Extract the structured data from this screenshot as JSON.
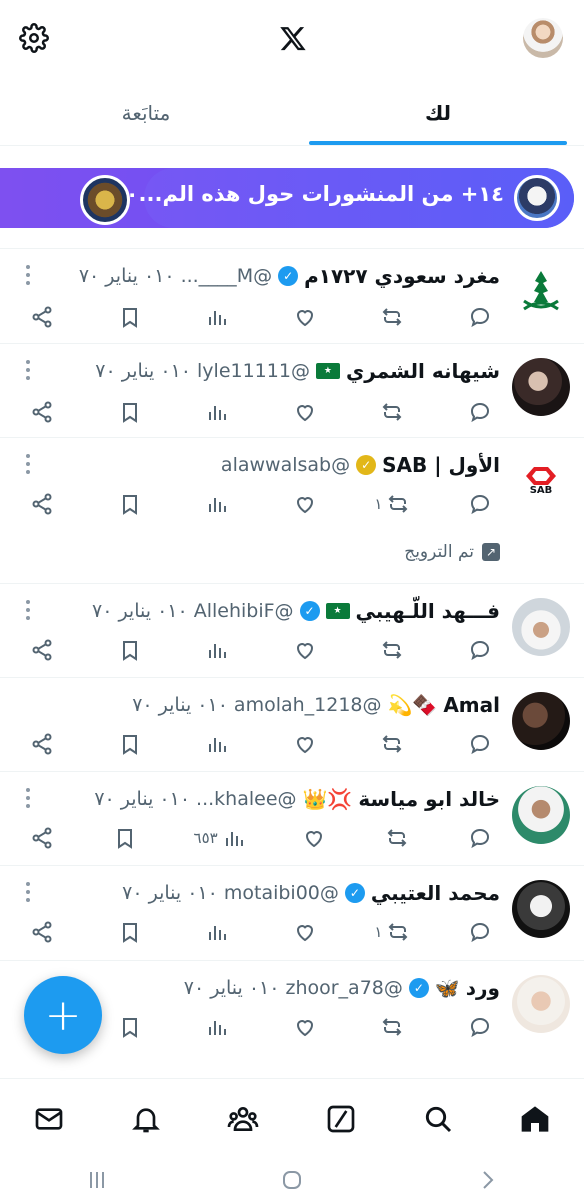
{
  "app": {
    "logo": "X"
  },
  "tabs": [
    {
      "label": "لك",
      "active": true
    },
    {
      "label": "متابَعة",
      "active": false
    }
  ],
  "banner": {
    "text": "١٤+ من المنشورات حول هذه الم...١٠"
  },
  "tweets": [
    {
      "name": "مغرد سعودي ١٧٢٧م",
      "verified": "blue",
      "handle": "@M____...",
      "date": "٠١٠ يناير ٧٠",
      "avatar": "saudi-emblem",
      "views": "",
      "retweets": ""
    },
    {
      "name": "شيهانه الشمري",
      "flag": "🇸🇦",
      "handle": "@lyle11111",
      "date": "٠١٠ يناير ٧٠",
      "avatar": "person",
      "views": "",
      "retweets": ""
    },
    {
      "name": "الأول | SAB",
      "verified": "gold",
      "handle": "@alawwalsab",
      "date": "",
      "avatar": "sab-logo",
      "views": "",
      "retweets": "١",
      "promoted": "تم الترويج"
    },
    {
      "name": "فـــهد اللّـهيبي",
      "flag": "🇸🇦",
      "verified": "blue",
      "handle": "@AllehibiF",
      "date": "٠١٠ يناير ٧٠",
      "avatar": "person",
      "views": "",
      "retweets": ""
    },
    {
      "name": "Amal",
      "emoji": "🍫💫",
      "handle": "@amolah_1218",
      "date": "٠١٠ يناير ٧٠",
      "avatar": "person",
      "views": "",
      "retweets": ""
    },
    {
      "name": "خالد ابو مياسة",
      "emoji": "💢👑",
      "handle": "@khalee...",
      "date": "٠١٠ يناير ٧٠",
      "avatar": "person",
      "views": "٦٥٣",
      "retweets": ""
    },
    {
      "name": "محمد العتيبي",
      "verified": "blue",
      "handle": "@motaibi00",
      "date": "٠١٠ يناير ٧٠",
      "avatar": "person",
      "views": "",
      "retweets": "١"
    },
    {
      "name": "ورد",
      "emoji": "🦋",
      "verified": "blue",
      "handle": "@zhoor_a78",
      "date": "٠١٠ يناير ٧٠",
      "avatar": "person",
      "views": "",
      "retweets": ""
    }
  ],
  "colors": {
    "accent": "#1d9bf0",
    "text": "#0f1419",
    "muted": "#536471",
    "bannerStart": "#7e50f0",
    "bannerEnd": "#4e66ff"
  },
  "fab": {
    "icon": "plus-icon"
  },
  "bottom_nav": [
    "mail-icon",
    "bell-icon",
    "communities-icon",
    "grok-icon",
    "search-icon",
    "home-icon"
  ]
}
